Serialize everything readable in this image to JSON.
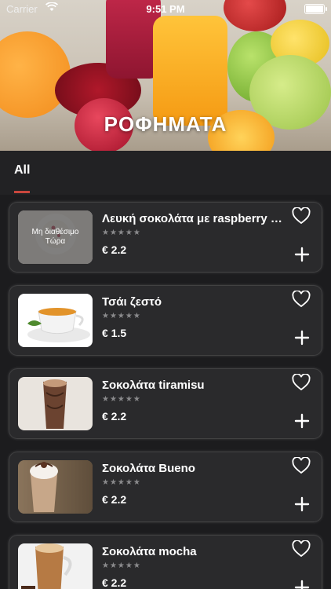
{
  "status_bar": {
    "carrier": "Carrier",
    "time": "9:51 PM"
  },
  "hero": {
    "title": "ΡΟΦΗΜΑΤΑ"
  },
  "tabs": [
    {
      "label": "All",
      "selected": true
    }
  ],
  "colors": {
    "accent": "#c9463d",
    "card": "#2a2a2c",
    "background": "#1c1c1e"
  },
  "products": [
    {
      "name": "Λευκή σοκολάτα με raspberry & ...",
      "rating": "★★★★★",
      "price": "€ 2.2",
      "badge": "Μη διαθέσιμο Τώρα"
    },
    {
      "name": "Τσάι ζεστό",
      "rating": "★★★★★",
      "price": "€ 1.5"
    },
    {
      "name": "Σοκολάτα tiramisu",
      "rating": "★★★★★",
      "price": "€ 2.2"
    },
    {
      "name": "Σοκολάτα Bueno",
      "rating": "★★★★★",
      "price": "€ 2.2"
    },
    {
      "name": "Σοκολάτα mocha",
      "rating": "★★★★★",
      "price": "€ 2.2"
    }
  ]
}
